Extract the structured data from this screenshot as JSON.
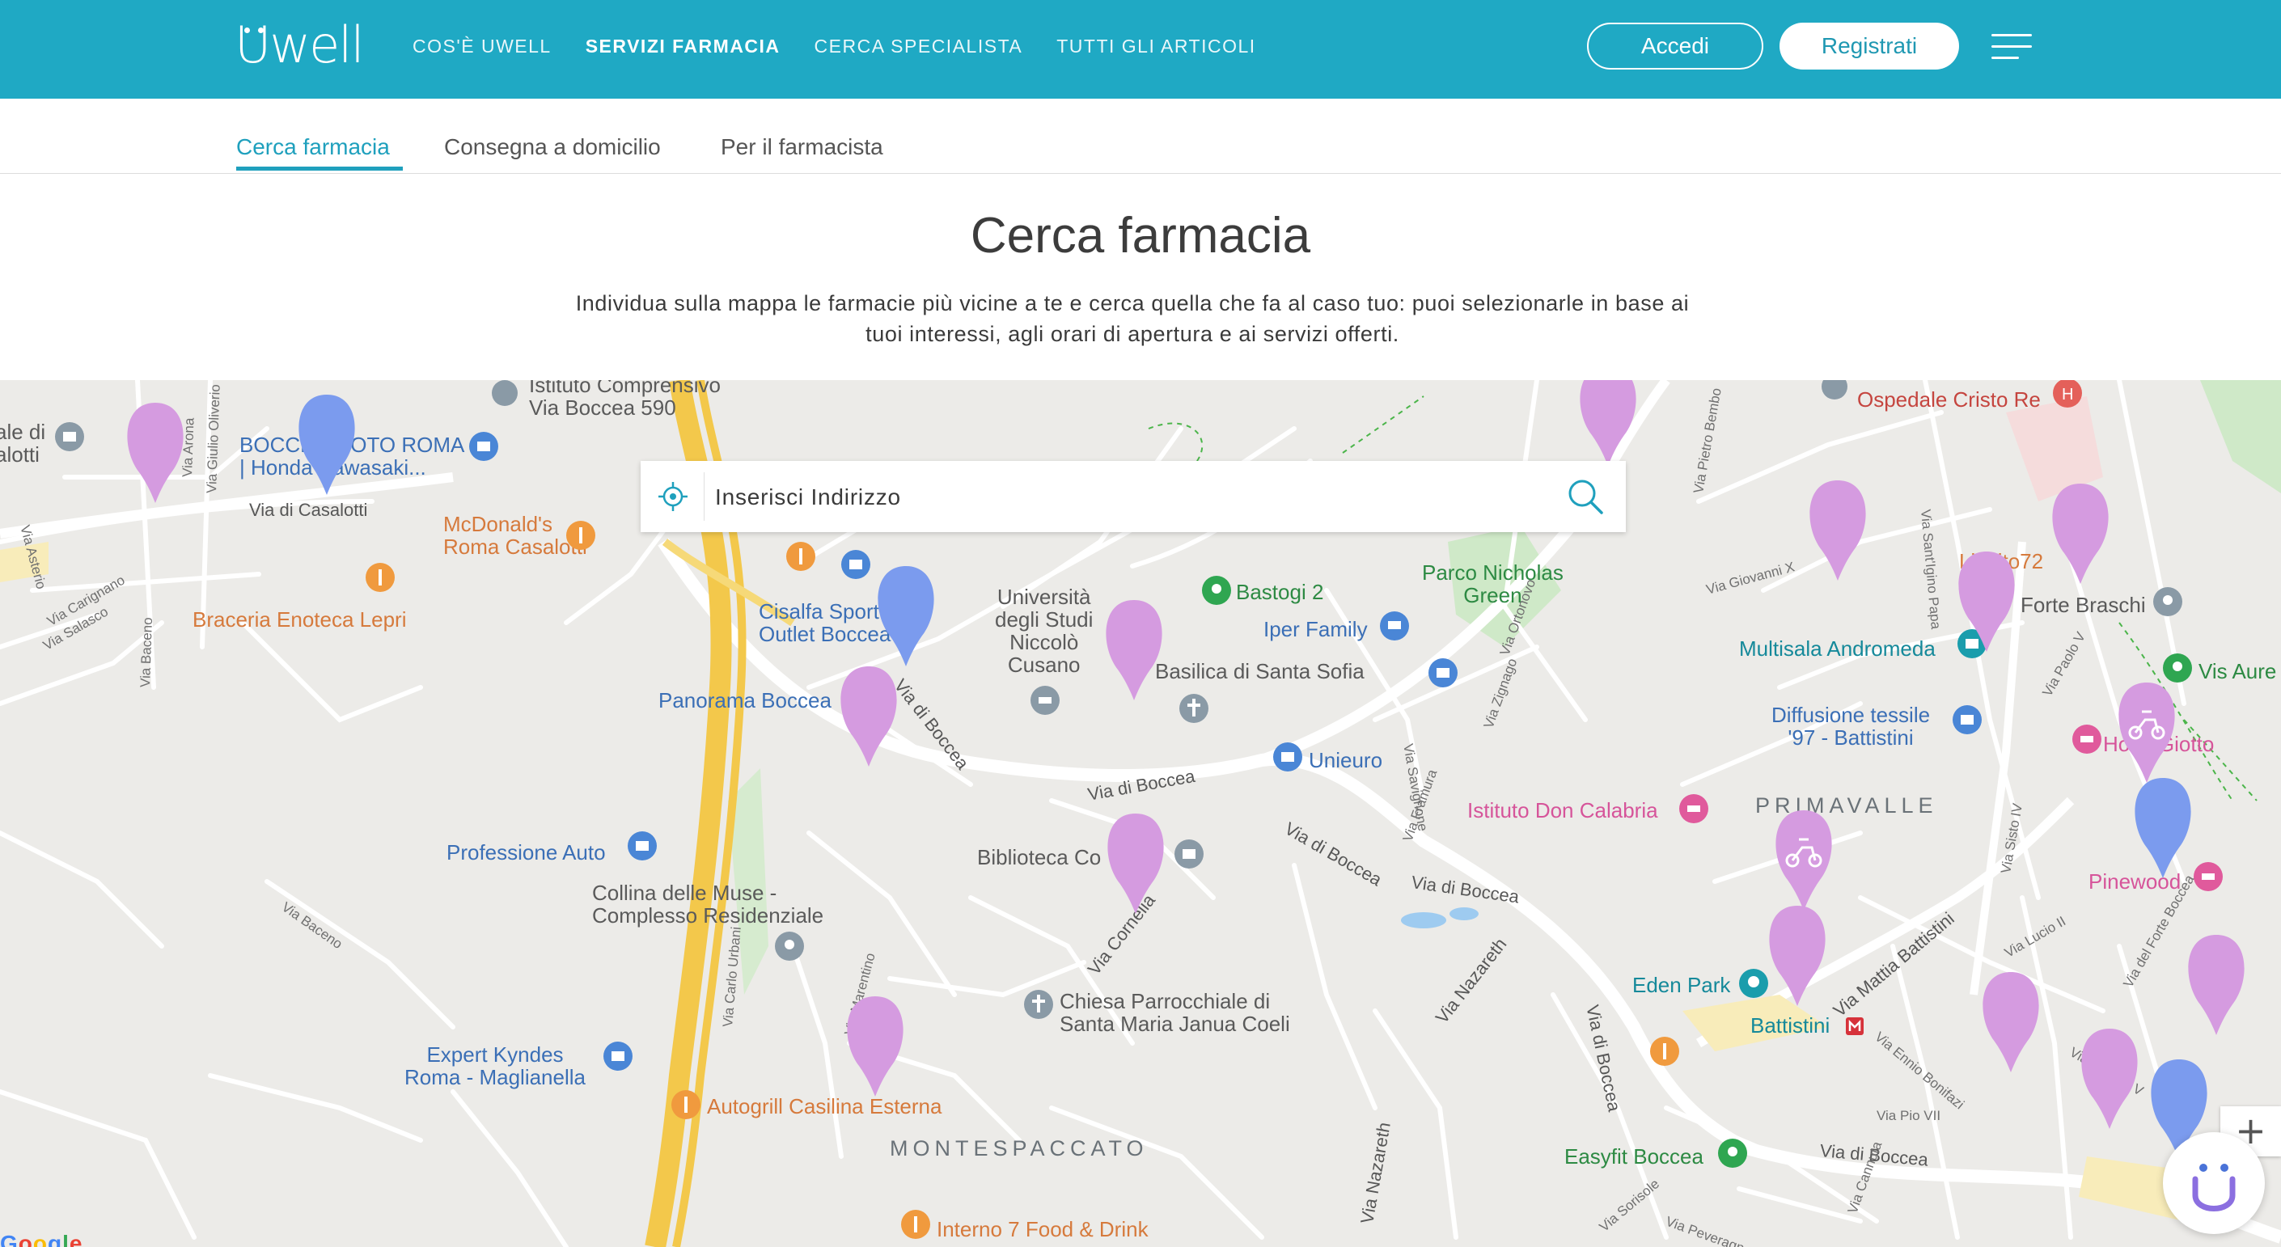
{
  "brand": {
    "name": "Uwell"
  },
  "nav": {
    "items": [
      "COS'È UWELL",
      "SERVIZI FARMACIA",
      "CERCA SPECIALISTA",
      "TUTTI GLI ARTICOLI"
    ],
    "active_index": 1
  },
  "auth": {
    "login_label": "Accedi",
    "register_label": "Registrati"
  },
  "tabs": {
    "items": [
      "Cerca farmacia",
      "Consegna a domicilio",
      "Per il farmacista"
    ],
    "active_index": 0
  },
  "heading": {
    "title": "Cerca farmacia",
    "intro_line1": "Individua sulla mappa le farmacie più vicine a te e cerca quella che fa al caso tuo: puoi selezionarle in base ai",
    "intro_line2": "tuoi interessi, agli orari di apertura e ai servizi offerti."
  },
  "search": {
    "placeholder": "Inserisci Indirizzo",
    "value": ""
  },
  "map": {
    "zoom_in_label": "+",
    "google_label": "Google",
    "places": {
      "istituto_l1": "Istituto Comprensivo",
      "istituto_l2": "Via Boccea 590",
      "ospedale": "Ospedale Cristo Re",
      "boccea_roma_l1": "BOCCEA MOTO ROMA",
      "boccea_roma_l2": "| Honda Kawasaki...",
      "mcdonalds_l1": "McDonald's",
      "mcdonalds_l2": "Roma Casalotti",
      "braceria": "Braceria Enoteca Lepri",
      "cisalfa_l1": "Cisalfa Sport",
      "cisalfa_l2": "Outlet Boccea",
      "panorama": "Panorama Boccea",
      "universita_l1": "Università",
      "universita_l2": "degli Studi",
      "universita_l3": "Niccolò",
      "universita_l4": "Cusano",
      "bastogi": "Bastogi 2",
      "iper_family": "Iper Family",
      "basilica": "Basilica di Santa Sofia",
      "parco_l1": "Parco Nicholas",
      "parco_l2": "Green",
      "lievito": "Lievito72",
      "forte_braschi": "Forte Braschi",
      "multisala": "Multisala Andromeda",
      "vis_aurelia": "Vis Aure",
      "diffusione_l1": "Diffusione tessile",
      "diffusione_l2": "'97 - Battistini",
      "hotel_giotto": "Hotel Giotto",
      "unieuro": "Unieuro",
      "primavalle": "PRIMAVALLE",
      "istituto_don": "Istituto Don Calabria",
      "professione_auto": "Professione Auto",
      "biblioteca": "Biblioteca Co",
      "collina_l1": "Collina delle Muse -",
      "collina_l2": "Complesso Residenziale",
      "pinewood": "Pinewood",
      "eden_park": "Eden Park",
      "battistini": "Battistini",
      "chiesa_l1": "Chiesa Parrocchiale di",
      "chiesa_l2": "Santa Maria Janua Coeli",
      "expert_l1": "Expert Kyndes",
      "expert_l2": "Roma - Maglianella",
      "autogrill": "Autogrill Casilina Esterna",
      "montespaccato": "MONTESPACCATO",
      "easyfit": "Easyfit Boccea",
      "interno7": "Interno 7 Food & Drink",
      "via_boccea_bottom": "Via di Boccea",
      "biancale_l1": "ale di",
      "biancale_l2": "alotti"
    },
    "streets": {
      "via_di_casalotti": "Via di Casalotti",
      "via_di_boccea_a": "Via di Boccea",
      "via_di_boccea_b": "Via di Boccea",
      "via_di_boccea_c": "Via di Boccea",
      "via_di_boccea_d": "Via di Boccea",
      "via_di_boccea_e": "Via di Boccea",
      "via_cornelia": "Via Cornelia",
      "via_nazareth_a": "Via Nazareth",
      "via_nazareth_b": "Via Nazareth",
      "via_mattia_battistini": "Via Mattia Battistini",
      "via_giulio_oliverio": "Via Giulio Oliverio",
      "via_arona": "Via Arona",
      "via_asterio": "Via Asterio",
      "via_carignano": "Via Carignano",
      "via_salasco": "Via Salasco",
      "via_baceno_a": "Via Baceno",
      "via_baceno_b": "Via Baceno",
      "via_pietro_bembo": "Via Pietro Bembo",
      "via_giovanni_x": "Via Giovanni X",
      "via_paolo_v": "Via Paolo V",
      "via_framura": "Via Framura",
      "via_savignone": "Via Savignone",
      "via_zignago": "Via Zignago",
      "via_ortonovo": "Via Ortonovo",
      "via_carlo_urbani": "Via Carlo Urbani",
      "via_marentino": "Via Marentino",
      "via_pio_vii": "Via Pio VII",
      "via_ennio_bonifazi": "Via Ennio Bonifazi",
      "via_lucio_ii": "Via Lucio II",
      "via_sisto_iv": "Via Sisto IV",
      "via_del_forte_boccea": "Via del Forte Boccea",
      "via_martino_v": "Via Martino V",
      "via_peveragno": "Via Peveragno",
      "via_sorisole": "Via Sorisole",
      "via_sant_igino_papa": "Via Sant'Igino Papa",
      "via_cannuta": "Via Cannuta"
    }
  },
  "colors": {
    "header_bg": "#1fa9c4",
    "accent": "#1fa0bd",
    "pin_purple": "#d59be0",
    "pin_blue": "#7b9bee",
    "map_bg": "#ecebe8"
  }
}
